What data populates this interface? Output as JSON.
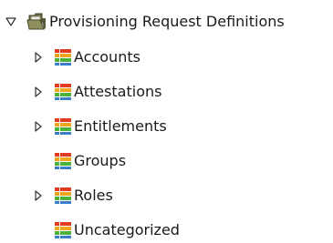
{
  "tree": {
    "root": {
      "label": "Provisioning Request Definitions",
      "expanded": true,
      "icon": "folder-icon"
    },
    "children": [
      {
        "label": "Accounts",
        "has_children": true,
        "expanded": false,
        "icon": "category-icon"
      },
      {
        "label": "Attestations",
        "has_children": true,
        "expanded": false,
        "icon": "category-icon"
      },
      {
        "label": "Entitlements",
        "has_children": true,
        "expanded": false,
        "icon": "category-icon"
      },
      {
        "label": "Groups",
        "has_children": false,
        "expanded": false,
        "icon": "category-icon"
      },
      {
        "label": "Roles",
        "has_children": true,
        "expanded": false,
        "icon": "category-icon"
      },
      {
        "label": "Uncategorized",
        "has_children": false,
        "expanded": false,
        "icon": "category-icon"
      }
    ]
  },
  "colors": {
    "text": "#1a1a1a",
    "category_row_colors": [
      "#e23b1f",
      "#f0a51b",
      "#4bb23a",
      "#3a7dc9"
    ],
    "folder_body": "#7b7b52",
    "folder_front": "#9a9a6a"
  }
}
